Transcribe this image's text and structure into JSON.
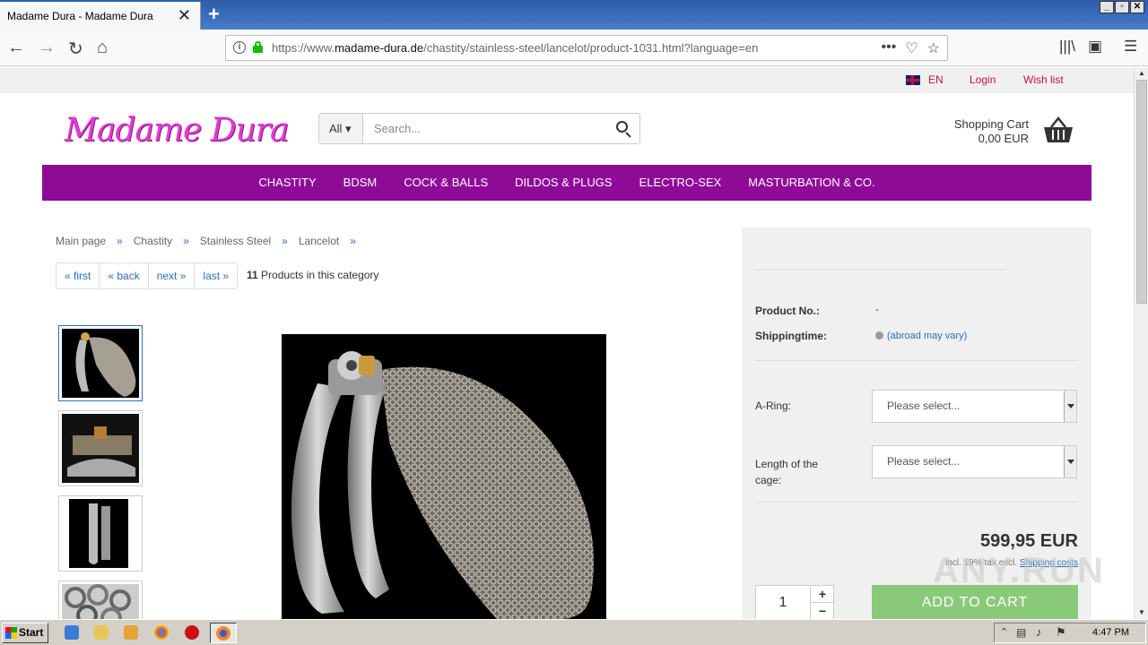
{
  "browser": {
    "tab_title": "Madame Dura - Madame Dura",
    "tab_close": "✕",
    "new_tab": "+",
    "url_prefix": "https://www.",
    "url_domain": "madame-dura.de",
    "url_path": "/chastity/stainless-steel/lancelot/product-1031.html?language=en",
    "window_buttons": [
      "_",
      "▫",
      "✕"
    ]
  },
  "topbar": {
    "language": "EN",
    "login": "Login",
    "wishlist": "Wish list"
  },
  "header": {
    "logo": "Madame Dura",
    "search_category": "All ▾",
    "search_placeholder": "Search...",
    "cart_label": "Shopping Cart",
    "cart_value": "0,00 EUR"
  },
  "menu": [
    "CHASTITY",
    "BDSM",
    "COCK & BALLS",
    "DILDOS & PLUGS",
    "ELECTRO-SEX",
    "MASTURBATION & CO."
  ],
  "breadcrumb": [
    "Main page",
    "Chastity",
    "Stainless Steel",
    "Lancelot"
  ],
  "breadcrumb_sep": "»",
  "pager": {
    "buttons": [
      "« first",
      "« back",
      "next »",
      "last »"
    ],
    "count": "11",
    "count_label": " Products in this category"
  },
  "product": {
    "product_no_label": "Product No.:",
    "product_no_value": "-",
    "shipping_label": "Shippingtime:",
    "shipping_value": "(abroad may vary)",
    "aring_label": "A-Ring:",
    "aring_value": "Please select...",
    "length_label": "Length of the cage:",
    "length_value": "Please select...",
    "price": "599,95 EUR",
    "tax_text": "incl. 19% tax excl. ",
    "shipping_link": "Shipping costs",
    "quantity": "1",
    "add_to_cart": "ADD TO CART"
  },
  "watermark": "ANY.RUN",
  "taskbar": {
    "start": "Start",
    "clock": "4:47 PM"
  }
}
